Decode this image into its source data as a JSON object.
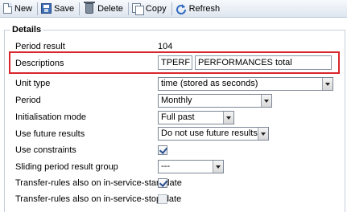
{
  "toolbar": {
    "new_label": "New",
    "save_label": "Save",
    "delete_label": "Delete",
    "copy_label": "Copy",
    "refresh_label": "Refresh"
  },
  "details": {
    "legend": "Details",
    "period_result_label": "Period result",
    "period_result_value": "104",
    "descriptions_label": "Descriptions",
    "descriptions_code": "TPERF",
    "descriptions_text": "PERFORMANCES total",
    "unit_type_label": "Unit type",
    "unit_type_value": "time (stored as seconds)",
    "period_label": "Period",
    "period_value": "Monthly",
    "init_mode_label": "Initialisation mode",
    "init_mode_value": "Full past",
    "future_results_label": "Use future results",
    "future_results_value": "Do not use future results",
    "use_constraints_label": "Use constraints",
    "use_constraints_checked": true,
    "sliding_label": "Sliding period result group",
    "sliding_value": "---",
    "transfer_start_label": "Transfer-rules also on in-service-start-date",
    "transfer_start_checked": true,
    "transfer_stop_label": "Transfer-rules also on in-service-stop-date",
    "transfer_stop_checked": false
  },
  "colors": {
    "highlight": "#d9262c",
    "toolbar_bg": "#dfe6ef"
  }
}
